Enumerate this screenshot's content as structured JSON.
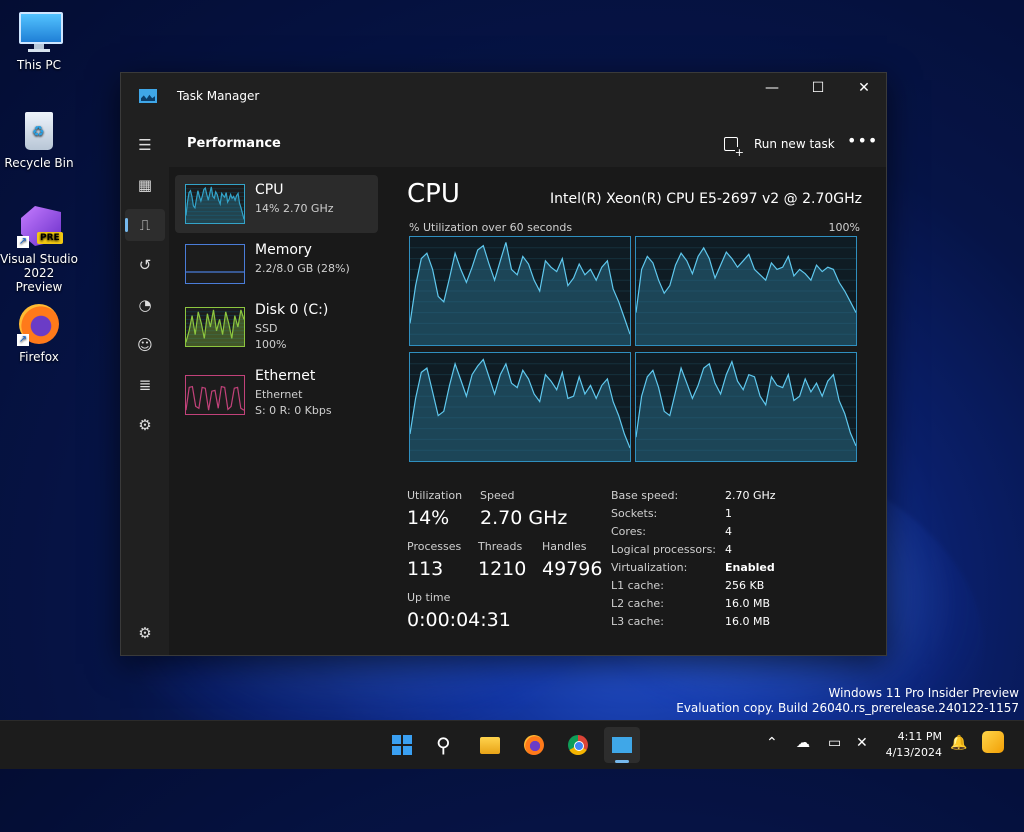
{
  "desktop": {
    "icons": [
      {
        "label": "This PC"
      },
      {
        "label": "Recycle Bin"
      },
      {
        "label": "Visual Studio 2022 Preview",
        "line1": "Visual Studio",
        "line2": "2022 Preview",
        "badge": "PRE"
      },
      {
        "label": "Firefox"
      }
    ],
    "watermark": {
      "line1": "Windows 11 Pro Insider Preview",
      "line2": "Evaluation copy. Build 26040.rs_prerelease.240122-1157"
    }
  },
  "window": {
    "title": "Task Manager",
    "controls": {
      "minimize": "—",
      "maximize": "☐",
      "close": "✕"
    }
  },
  "nav": {
    "icons": [
      "hamburger-icon",
      "processes-icon",
      "performance-icon",
      "app-history-icon",
      "startup-apps-icon",
      "users-icon",
      "details-icon",
      "services-icon",
      "settings-icon"
    ],
    "active": "performance-icon"
  },
  "header": {
    "page_title": "Performance",
    "run_new_task": "Run new task",
    "more": "•••"
  },
  "resources": [
    {
      "name": "CPU",
      "sub1": "14% 2.70 GHz",
      "sub2": "",
      "color": "#33a3c8"
    },
    {
      "name": "Memory",
      "sub1": "2.2/8.0 GB (28%)",
      "sub2": "",
      "color": "#4a7cd8"
    },
    {
      "name": "Disk 0 (C:)",
      "sub1": "SSD",
      "sub2": "100%",
      "color": "#8cc63f"
    },
    {
      "name": "Ethernet",
      "sub1": "Ethernet",
      "sub2": "S: 0 R: 0 Kbps",
      "color": "#c2427a"
    }
  ],
  "cpu": {
    "title": "CPU",
    "model": "Intel(R) Xeon(R) CPU E5-2697 v2 @ 2.70GHz",
    "graph_caption": "% Utilization over 60 seconds",
    "graph_max": "100%",
    "core_series": [
      [
        20,
        55,
        80,
        85,
        70,
        45,
        40,
        62,
        85,
        70,
        58,
        72,
        88,
        92,
        75,
        60,
        78,
        95,
        70,
        65,
        82,
        75,
        60,
        50,
        78,
        72,
        68,
        80,
        55,
        62,
        75,
        65,
        70,
        60,
        72,
        78,
        52,
        40,
        25,
        10
      ],
      [
        30,
        70,
        82,
        76,
        60,
        48,
        55,
        74,
        85,
        78,
        66,
        82,
        90,
        80,
        62,
        74,
        86,
        80,
        72,
        78,
        84,
        70,
        65,
        60,
        76,
        70,
        72,
        82,
        64,
        70,
        66,
        60,
        74,
        68,
        72,
        70,
        58,
        50,
        40,
        30
      ],
      [
        25,
        58,
        82,
        86,
        64,
        42,
        46,
        70,
        90,
        75,
        60,
        80,
        88,
        94,
        78,
        62,
        80,
        90,
        72,
        68,
        84,
        76,
        62,
        55,
        80,
        74,
        66,
        82,
        58,
        60,
        78,
        62,
        70,
        58,
        70,
        76,
        55,
        42,
        25,
        12
      ],
      [
        22,
        60,
        78,
        84,
        68,
        46,
        42,
        64,
        86,
        72,
        58,
        70,
        86,
        90,
        72,
        62,
        80,
        92,
        74,
        66,
        80,
        78,
        60,
        52,
        78,
        70,
        68,
        80,
        56,
        60,
        76,
        64,
        72,
        60,
        74,
        80,
        56,
        44,
        26,
        14
      ]
    ],
    "stats": {
      "utilization_label": "Utilization",
      "utilization": "14%",
      "speed_label": "Speed",
      "speed": "2.70 GHz",
      "processes_label": "Processes",
      "processes": "113",
      "threads_label": "Threads",
      "threads": "1210",
      "handles_label": "Handles",
      "handles": "49796",
      "uptime_label": "Up time",
      "uptime": "0:00:04:31"
    },
    "specs": [
      {
        "k": "Base speed:",
        "v": "2.70 GHz"
      },
      {
        "k": "Sockets:",
        "v": "1"
      },
      {
        "k": "Cores:",
        "v": "4"
      },
      {
        "k": "Logical processors:",
        "v": "4"
      },
      {
        "k": "Virtualization:",
        "v": "Enabled"
      },
      {
        "k": "L1 cache:",
        "v": "256 KB"
      },
      {
        "k": "L2 cache:",
        "v": "16.0 MB"
      },
      {
        "k": "L3 cache:",
        "v": "16.0 MB"
      }
    ]
  },
  "taskbar": {
    "apps": [
      "start-icon",
      "search-icon",
      "file-explorer-icon",
      "firefox-icon",
      "chrome-icon",
      "task-manager-icon"
    ],
    "clock_time": "4:11 PM",
    "clock_date": "4/13/2024",
    "tray": [
      "chevron-up-icon",
      "onedrive-icon",
      "display-icon",
      "volume-muted-icon",
      "notification-bell-icon",
      "copilot-icon"
    ]
  }
}
